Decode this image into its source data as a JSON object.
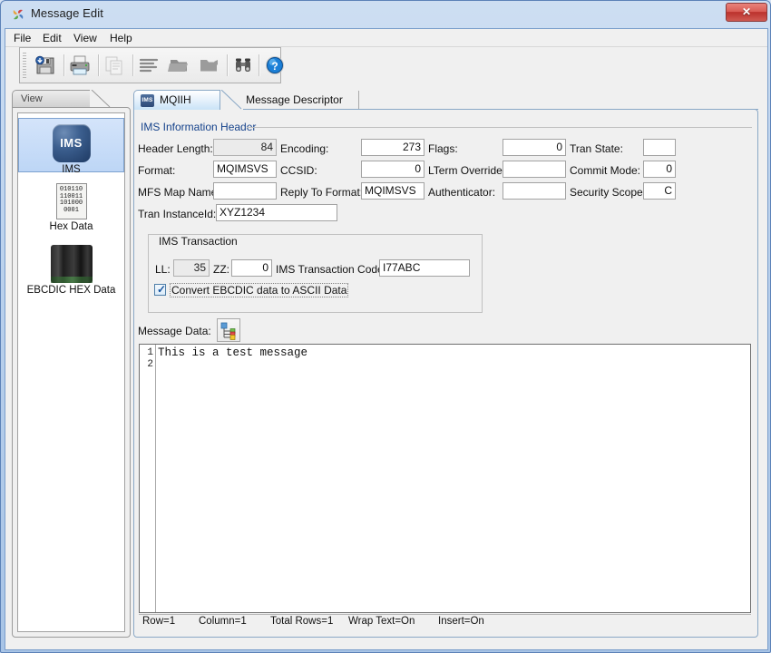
{
  "window": {
    "title": "Message Edit",
    "close_label": "✕",
    "app_icon": "pinwheel-icon"
  },
  "menubar": {
    "items": [
      {
        "label": "File"
      },
      {
        "label": "Edit"
      },
      {
        "label": "View"
      },
      {
        "label": "Help"
      }
    ]
  },
  "toolbar": {
    "buttons": [
      {
        "name": "save-button",
        "icon": "floppy-disk-icon",
        "enabled": true
      },
      {
        "name": "print-button",
        "icon": "printer-icon",
        "enabled": true
      },
      {
        "name": "copy-button",
        "icon": "copy-pages-icon",
        "enabled": false
      },
      {
        "name": "align-button",
        "icon": "align-lines-icon",
        "enabled": true
      },
      {
        "name": "open-folder-button",
        "icon": "folder-open-icon",
        "enabled": true
      },
      {
        "name": "folder-button",
        "icon": "folder-icon",
        "enabled": true
      },
      {
        "name": "find-button",
        "icon": "binoculars-icon",
        "enabled": true
      },
      {
        "name": "help-button",
        "icon": "question-help-icon",
        "enabled": true
      }
    ]
  },
  "sidebar": {
    "tab_label": "View",
    "items": [
      {
        "label": "IMS",
        "icon": "ims-logo-icon",
        "selected": true
      },
      {
        "label": "Hex Data",
        "icon": "binary-page-icon",
        "selected": false
      },
      {
        "label": "EBCDIC HEX Data",
        "icon": "disk-stack-icon",
        "selected": false
      }
    ]
  },
  "main": {
    "tabs": [
      {
        "label": "MQIIH",
        "icon": "ims-tab-icon",
        "icon_text": "IMS",
        "active": true
      },
      {
        "label": "Message Descriptor",
        "active": false
      }
    ],
    "header_group": {
      "title": "IMS Information Header",
      "fields": [
        {
          "name": "header-length",
          "label": "Header Length:",
          "value": "84",
          "readonly": true,
          "align": "right"
        },
        {
          "name": "encoding",
          "label": "Encoding:",
          "value": "273",
          "readonly": false,
          "align": "right"
        },
        {
          "name": "flags",
          "label": "Flags:",
          "value": "0",
          "readonly": false,
          "align": "right"
        },
        {
          "name": "tran-state",
          "label": "Tran State:",
          "value": "",
          "readonly": false,
          "align": "right"
        },
        {
          "name": "format",
          "label": "Format:",
          "value": "MQIMSVS",
          "readonly": false,
          "align": "left"
        },
        {
          "name": "ccsid",
          "label": "CCSID:",
          "value": "0",
          "readonly": false,
          "align": "right"
        },
        {
          "name": "lterm-override",
          "label": "LTerm Override:",
          "value": "",
          "readonly": false,
          "align": "left"
        },
        {
          "name": "commit-mode",
          "label": "Commit Mode:",
          "value": "0",
          "readonly": false,
          "align": "right"
        },
        {
          "name": "mfs-map-name",
          "label": "MFS Map Name:",
          "value": "",
          "readonly": false,
          "align": "left"
        },
        {
          "name": "reply-to-format",
          "label": "Reply To Format:",
          "value": "MQIMSVS",
          "readonly": false,
          "align": "left"
        },
        {
          "name": "authenticator",
          "label": "Authenticator:",
          "value": "",
          "readonly": false,
          "align": "left"
        },
        {
          "name": "security-scope",
          "label": "Security Scope:",
          "value": "C",
          "readonly": false,
          "align": "right"
        },
        {
          "name": "tran-instance-id",
          "label": "Tran InstanceId:",
          "value": "XYZ1234",
          "readonly": false,
          "align": "left"
        }
      ]
    },
    "transaction_group": {
      "title": "IMS Transaction",
      "ll": {
        "label": "LL:",
        "value": "35"
      },
      "zz": {
        "label": "ZZ:",
        "value": "0"
      },
      "tran_code": {
        "label": "IMS Transaction Code:",
        "value": "I77ABC"
      },
      "convert_checkbox": {
        "label": "Convert EBCDIC data to ASCII Data",
        "checked": true
      }
    },
    "message_data": {
      "label": "Message Data:",
      "button_icon": "structure-tree-icon",
      "line_numbers": [
        "1",
        "2"
      ],
      "text": "This is a test message"
    },
    "statusbar": {
      "row": "Row=1",
      "column": "Column=1",
      "total_rows": "Total Rows=1",
      "wrap_text": "Wrap Text=On",
      "insert": "Insert=On"
    }
  },
  "colors": {
    "titlebar_accent": "#a8c4e6",
    "group_title": "#15428b",
    "close_button": "#bb312c",
    "selection": "#bdd6f6"
  }
}
